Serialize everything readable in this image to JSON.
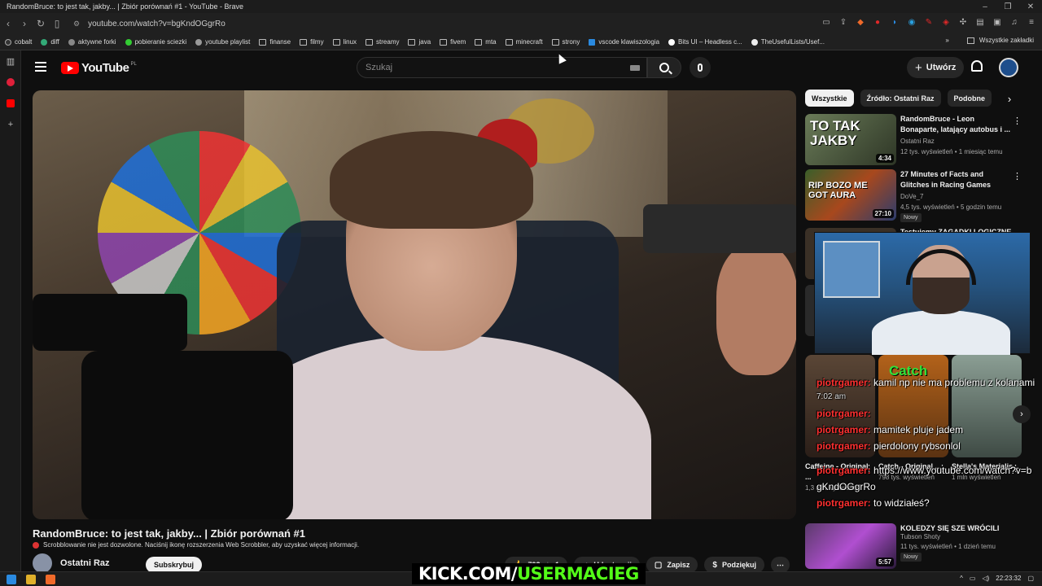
{
  "browser": {
    "window_title": "RandomBruce: to jest tak, jakby... | Zbiór porównań #1 - YouTube - Brave",
    "url": "youtube.com/watch?v=bgKndOGgrRo",
    "bookmarks": [
      "cobalt",
      "diff",
      "aktywne forki",
      "pobieranie sciezki",
      "youtube playlist",
      "finanse",
      "filmy",
      "linux",
      "streamy",
      "java",
      "fivem",
      "mta",
      "minecraft",
      "strony",
      "vscode klawiszologia",
      "Bits UI – Headless c...",
      "TheUsefulLists/Usef..."
    ],
    "bookmarks_more": "»",
    "all_bookmarks": "Wszystkie zakładki"
  },
  "youtube": {
    "logo_text": "YouTube",
    "logo_region": "PL",
    "search_placeholder": "Szukaj",
    "create_label": "Utwórz"
  },
  "video": {
    "title": "RandomBruce: to jest tak, jakby... | Zbiór porównań #1",
    "scrobbler_notice": "Scrobblowanie nie jest dozwolone. Naciśnij ikonę rozszerzenia Web Scrobbler, aby uzyskać więcej informacji.",
    "channel": "Ostatni Raz",
    "subscribe": "Subskrybuj",
    "likes": "793",
    "dislikes": "1",
    "share": "Udostępnij",
    "save": "Zapisz",
    "thanks": "Podziękuj"
  },
  "chips": [
    "Wszystkie",
    "Źródło: Ostatni Raz",
    "Podobne"
  ],
  "recommendations": [
    {
      "thumb_text": "TO TAK JAKBY",
      "duration": "4:34",
      "title": "RandomBruce - Leon Bonaparte, latający autobus i ...",
      "channel": "Ostatni Raz",
      "meta": "12 tys. wyświetleń • 1 miesiąc temu",
      "badge": ""
    },
    {
      "thumb_text": "RIP BOZO ME GOT AURA",
      "duration": "27:10",
      "title": "27 Minutes of Facts and Glitches in Racing Games",
      "channel": "DoVe_7",
      "meta": "4,5 tys. wyświetleń • 5 godzin temu",
      "badge": "Nowy"
    },
    {
      "thumb_text": "",
      "duration": "5:57",
      "title": "KOLEDZY SIĘ SZE WRÓCILI",
      "channel": "Tubson Shoty",
      "meta": "11 tys. wyświetleń • 1 dzień temu",
      "badge": "Nowy"
    }
  ],
  "partial_rec_title": "Testujemy ZAGADKI LOGICZNE",
  "shorts": [
    {
      "name": "Caffeine - Original ...",
      "views": "1,3 mln wyświetleń"
    },
    {
      "name": "Catch - Original ...",
      "views": "798 tys. wyświetleń"
    },
    {
      "name": "Stella's Materialis...",
      "views": "1 mln wyświetleń"
    }
  ],
  "overlay_chat": [
    {
      "user": "piotrgamer:",
      "msg": "kamil np nie ma problemu z kolanami",
      "time": "7:02 am"
    },
    {
      "user": "piotrgamer:",
      "msg": "",
      "time": ""
    },
    {
      "user": "piotrgamer:",
      "msg": "mamitek pluje jadem",
      "time": ""
    },
    {
      "user": "piotrgamer:",
      "msg": "pierdolony rybsonlol",
      "time": ""
    },
    {
      "user": "piotrgamer:",
      "msg": "https://www.youtube.com/watch?v=bgKndOGgrRo",
      "time": ""
    },
    {
      "user": "piotrgamer:",
      "msg": "to widziałeś?",
      "time": ""
    }
  ],
  "overlay_catch": "Catch",
  "stream_banner": {
    "prefix": "KICK.COM/",
    "name": "USERMACIEG"
  },
  "taskbar": {
    "time": "22:23:32"
  }
}
